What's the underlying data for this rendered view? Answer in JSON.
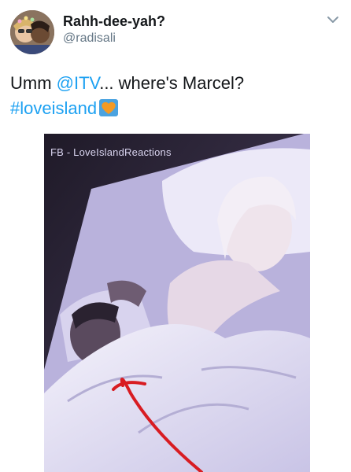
{
  "tweet": {
    "display_name": "Rahh-dee-yah?",
    "handle": "@radisali",
    "text_prefix": "Umm ",
    "mention": "@ITV",
    "text_middle": "... where's Marcel?",
    "hashtag": "#loveisland"
  },
  "media": {
    "watermark": "FB - LoveIslandReactions"
  },
  "icons": {
    "more": "chevron-down-icon",
    "emoji": "orange-heart-emoji"
  },
  "colors": {
    "link": "#1da1f2",
    "text": "#14171a",
    "secondary": "#657786",
    "annotation": "#d81c22"
  }
}
